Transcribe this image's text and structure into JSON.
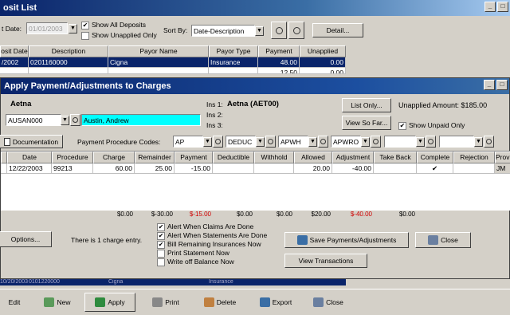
{
  "deposit_list": {
    "title": "osit List",
    "date_label": "t Date:",
    "date_value": "01/01/2003",
    "show_all_deposits": "Show All Deposits",
    "show_unapplied_only": "Show Unapplied Only",
    "sort_by_label": "Sort By:",
    "sort_by_value": "Date-Description",
    "detail_button": "Detail...",
    "columns": [
      "osit Date",
      "Description",
      "Payor Name",
      "Payor Type",
      "Payment",
      "Unapplied"
    ],
    "rows": [
      [
        "/2002",
        "0201160000",
        "Cigna",
        "Insurance",
        "48.00",
        "0.00"
      ],
      [
        "",
        "",
        "",
        "",
        "12.50",
        "0.00"
      ]
    ],
    "bottom_row": [
      "10/20/2003",
      "0101220000",
      "Cigna",
      "Insurance",
      "",
      ""
    ]
  },
  "apply_window": {
    "title": "Apply Payment/Adjustments to Charges",
    "payor_name": "Aetna",
    "patient_code": "AUSAN000",
    "patient_name": "Austin, Andrew",
    "ins1_label": "Ins 1:",
    "ins1_value": "Aetna (AET00)",
    "ins2_label": "Ins 2:",
    "ins3_label": "Ins 3:",
    "list_only_button": "List Only...",
    "view_so_far_button": "View So Far...",
    "unapplied_amount": "Unapplied Amount: $185.00",
    "show_unpaid_only": "Show Unpaid Only",
    "documentation_button": "Documentation",
    "payment_procedure_codes_label": "Payment Procedure Codes:",
    "codes": [
      "AP",
      "DEDUC",
      "APWH",
      "APWRO",
      "",
      ""
    ],
    "columns": [
      "Date",
      "Procedure",
      "Charge",
      "Remainder",
      "Payment",
      "Deductible",
      "Withhold",
      "Allowed",
      "Adjustment",
      "Take Back",
      "Complete",
      "Rejection",
      "Provi"
    ],
    "row": {
      "date": "12/22/2003",
      "procedure": "99213",
      "charge": "60.00",
      "remainder": "25.00",
      "payment": "-15.00",
      "deductible": "",
      "withhold": "",
      "allowed": "20.00",
      "adjustment": "-40.00",
      "take_back": "",
      "complete": "✔",
      "rejection": "",
      "provider": "JM"
    },
    "totals": [
      "$0.00",
      "$-30.00",
      "$-15.00",
      "$0.00",
      "$0.00",
      "$20.00",
      "$-40.00",
      "$0.00"
    ],
    "options_button": "Options...",
    "charge_entry_text": "There is 1 charge entry.",
    "checkboxes": [
      {
        "label": "Alert When Claims Are Done",
        "checked": true
      },
      {
        "label": "Alert When Statements Are Done",
        "checked": true
      },
      {
        "label": "Bill Remaining Insurances Now",
        "checked": true
      },
      {
        "label": "Print Statement Now",
        "checked": false
      },
      {
        "label": "Write off Balance Now",
        "checked": false
      }
    ],
    "save_button": "Save Payments/Adjustments",
    "close_button": "Close",
    "view_transactions_button": "View Transactions"
  },
  "toolbar": {
    "edit": "Edit",
    "new": "New",
    "apply": "Apply",
    "print": "Print",
    "delete": "Delete",
    "export": "Export",
    "close": "Close"
  },
  "colors": {
    "title_blue": "#0a246a",
    "selection_blue": "#0a246a",
    "highlight_cyan": "#00ffff",
    "negative_red": "#d00000"
  }
}
